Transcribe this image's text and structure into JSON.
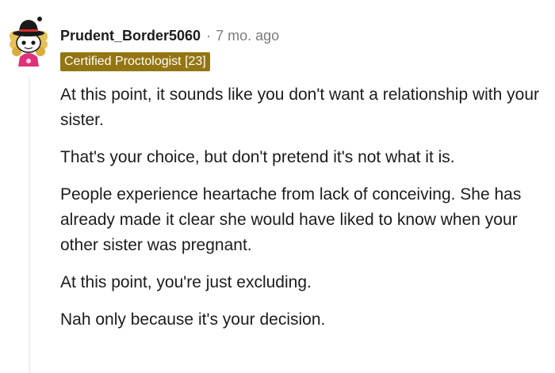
{
  "comment": {
    "author": "Prudent_Border5060",
    "separator": "·",
    "timestamp": "7 mo. ago",
    "flair": "Certified Proctologist [23]",
    "paragraphs": [
      "At this point, it sounds like you don't want a relationship with your sister.",
      "That's your choice, but don't pretend it's not what it is.",
      "People experience heartache from lack of conceiving. She has already made it clear she would have liked to know when your other sister was pregnant.",
      "At this point, you're just excluding.",
      "Nah only because it's your decision."
    ]
  },
  "colors": {
    "flair_bg": "#937511",
    "flair_text": "#ffffff",
    "text": "#1c1c1c",
    "meta": "#7c7c7c",
    "thread_line": "#edeff1"
  },
  "icons": {
    "avatar": "snoo-avatar-icon"
  }
}
